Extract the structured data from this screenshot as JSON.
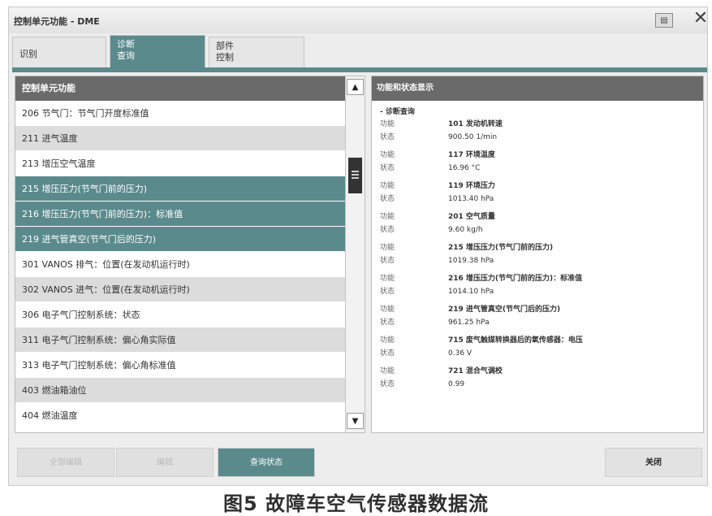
{
  "window": {
    "title": "控制单元功能 - DME",
    "print_icon": "printer-icon",
    "close_icon": "close-icon"
  },
  "tabs": [
    {
      "label": "识别"
    },
    {
      "label": "诊断\n查询"
    },
    {
      "label": "部件\n控制"
    }
  ],
  "left_panel": {
    "header": "控制单元功能",
    "items": [
      "206 节气门：节气门开度标准值",
      "211 进气温度",
      "213 增压空气温度",
      "215 增压压力(节气门前的压力)",
      "216 增压压力(节气门前的压力)：标准值",
      "219 进气管真空(节气门后的压力)",
      "301 VANOS 排气：位置(在发动机运行时)",
      "302 VANOS 进气：位置(在发动机运行时)",
      "306 电子气门控制系统：状态",
      "311 电子气门控制系统：偏心角实际值",
      "313 电子气门控制系统：偏心角标准值",
      "403 燃油箱油位",
      "404 燃油温度"
    ],
    "scroll_up": "▲",
    "scroll_down": "▼"
  },
  "right_panel": {
    "header": "功能和状态显示",
    "section": "- 诊断查询",
    "func_label": "功能",
    "status_label": "状态",
    "entries": [
      {
        "function": "101 发动机转速",
        "status": "900.50 1/min"
      },
      {
        "function": "117 环境温度",
        "status": "16.96 °C"
      },
      {
        "function": "119 环境压力",
        "status": "1013.40 hPa"
      },
      {
        "function": "201 空气质量",
        "status": "9.60 kg/h"
      },
      {
        "function": "215 增压压力(节气门前的压力)",
        "status": "1019.38 hPa"
      },
      {
        "function": "216 增压压力(节气门前的压力)：标准值",
        "status": "1014.10 hPa"
      },
      {
        "function": "219 进气管真空(节气门后的压力)",
        "status": "961.25 hPa"
      },
      {
        "function": "715 废气触媒转换器后的氧传感器：电压",
        "status": "0.36 V"
      },
      {
        "function": "721 混合气调校",
        "status": "0.99"
      }
    ]
  },
  "buttons": {
    "all_edit": "全部编辑",
    "edit": "编辑",
    "query": "查询状态",
    "close": "关闭"
  },
  "caption": "图5 故障车空气传感器数据流",
  "colors": {
    "accent": "#5b8a8c",
    "header": "#6a6a6a"
  }
}
